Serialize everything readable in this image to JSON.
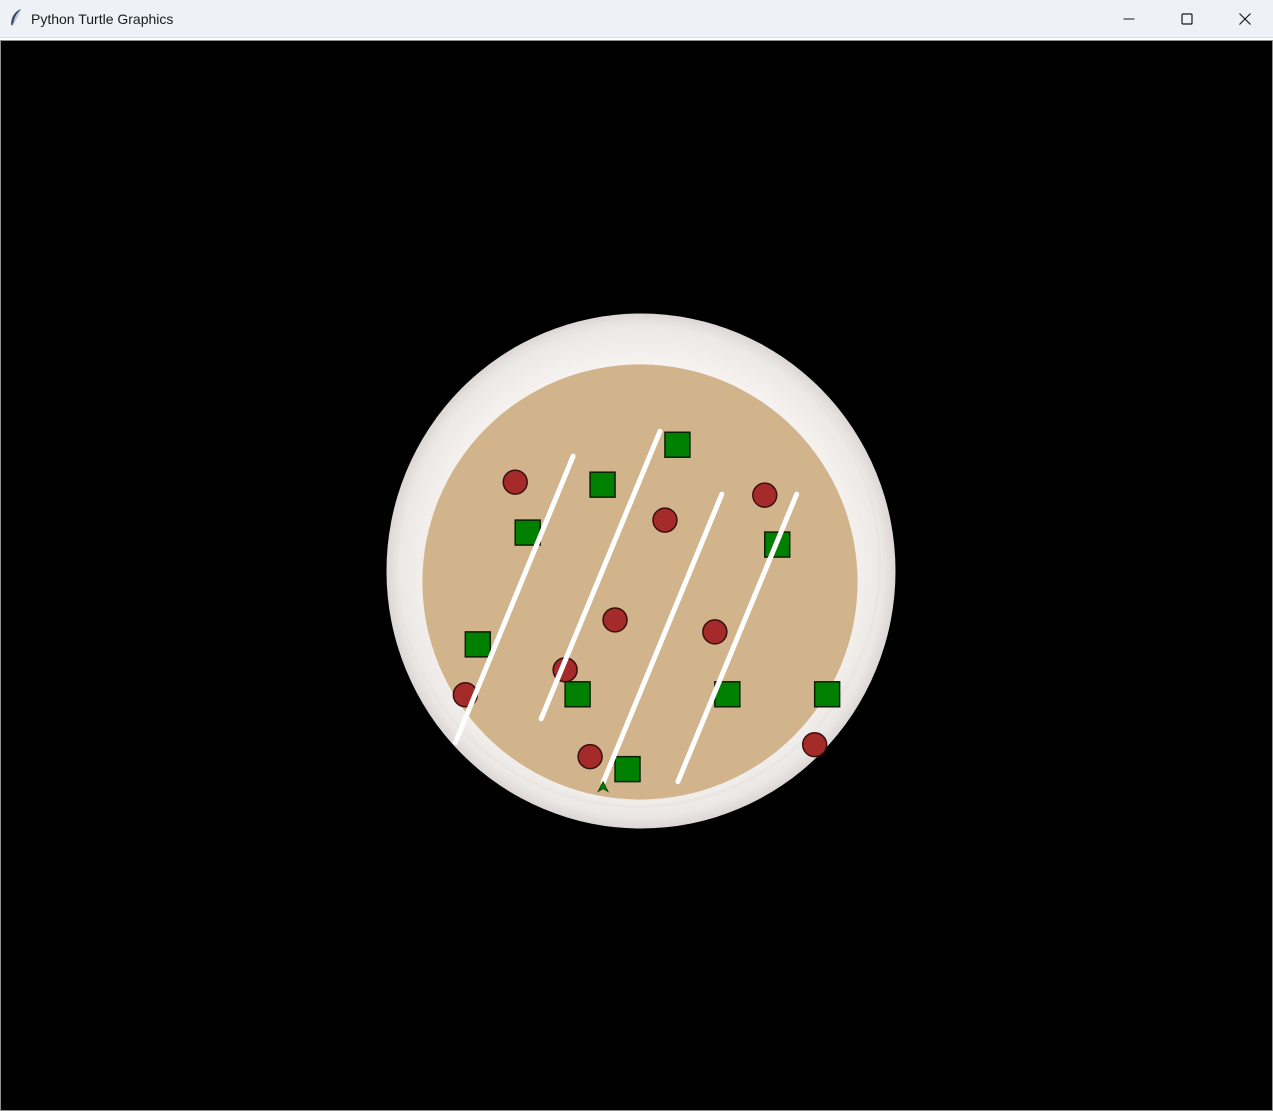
{
  "window": {
    "title": "Python Turtle Graphics",
    "icon": "feather-icon",
    "controls": [
      "minimize-icon",
      "maximize-icon",
      "close-icon"
    ]
  },
  "canvas": {
    "background_color": "#000000",
    "plate_color": "#f3f0ee",
    "dough_color": "#d2b48c",
    "pepperoni_color": "#a52a2a",
    "topping_square_color": "#008000",
    "sauce_stripe_color": "#ffffff",
    "turtle_color": "#008000"
  }
}
